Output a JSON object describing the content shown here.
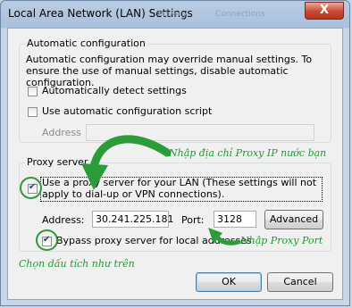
{
  "window": {
    "title": "Local Area Network (LAN) Settings",
    "close_label": "X",
    "ghost_tabs": [
      "Privacy",
      "Connections"
    ]
  },
  "auto_config": {
    "legend": "Automatic configuration",
    "description": "Automatic configuration may override manual settings. To ensure the use of manual settings, disable automatic configuration.",
    "auto_detect": {
      "label": "Automatically detect settings",
      "checked": false
    },
    "use_script": {
      "label": "Use automatic configuration script",
      "checked": false
    },
    "address_label": "Address",
    "address_value": ""
  },
  "proxy": {
    "legend": "Proxy server",
    "use_proxy": {
      "label": "Use a proxy server for your LAN (These settings will not apply to dial-up or VPN connections).",
      "checked": true
    },
    "address_label": "Address:",
    "address_value": "30.241.225.181",
    "port_label": "Port:",
    "port_value": "3128",
    "advanced_label": "Advanced",
    "bypass": {
      "label": "Bypass proxy server for local addresses",
      "checked": true
    }
  },
  "buttons": {
    "ok": "OK",
    "cancel": "Cancel"
  },
  "annotations": {
    "enter_ip": "Nhập địa chỉ Proxy IP nước bạn",
    "enter_port": "Nhập Proxy Port",
    "check_boxes": "Chọn dấu tích như trên"
  },
  "colors": {
    "annotation_green": "#1e9b2c"
  }
}
